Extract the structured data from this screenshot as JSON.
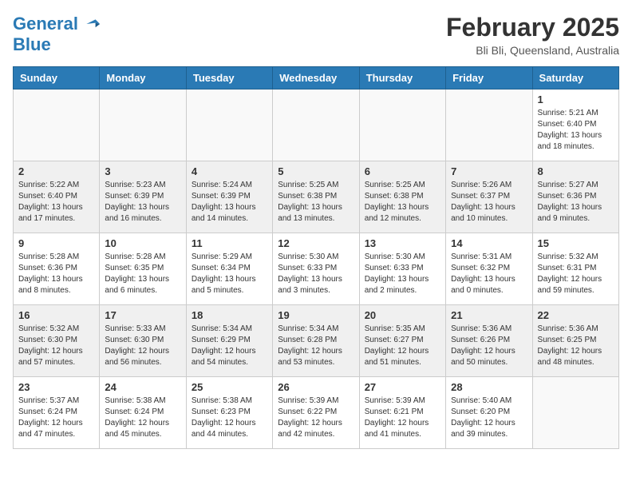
{
  "header": {
    "logo_line1": "General",
    "logo_line2": "Blue",
    "month_title": "February 2025",
    "location": "Bli Bli, Queensland, Australia"
  },
  "weekdays": [
    "Sunday",
    "Monday",
    "Tuesday",
    "Wednesday",
    "Thursday",
    "Friday",
    "Saturday"
  ],
  "weeks": [
    [
      {
        "day": "",
        "info": ""
      },
      {
        "day": "",
        "info": ""
      },
      {
        "day": "",
        "info": ""
      },
      {
        "day": "",
        "info": ""
      },
      {
        "day": "",
        "info": ""
      },
      {
        "day": "",
        "info": ""
      },
      {
        "day": "1",
        "info": "Sunrise: 5:21 AM\nSunset: 6:40 PM\nDaylight: 13 hours\nand 18 minutes."
      }
    ],
    [
      {
        "day": "2",
        "info": "Sunrise: 5:22 AM\nSunset: 6:40 PM\nDaylight: 13 hours\nand 17 minutes."
      },
      {
        "day": "3",
        "info": "Sunrise: 5:23 AM\nSunset: 6:39 PM\nDaylight: 13 hours\nand 16 minutes."
      },
      {
        "day": "4",
        "info": "Sunrise: 5:24 AM\nSunset: 6:39 PM\nDaylight: 13 hours\nand 14 minutes."
      },
      {
        "day": "5",
        "info": "Sunrise: 5:25 AM\nSunset: 6:38 PM\nDaylight: 13 hours\nand 13 minutes."
      },
      {
        "day": "6",
        "info": "Sunrise: 5:25 AM\nSunset: 6:38 PM\nDaylight: 13 hours\nand 12 minutes."
      },
      {
        "day": "7",
        "info": "Sunrise: 5:26 AM\nSunset: 6:37 PM\nDaylight: 13 hours\nand 10 minutes."
      },
      {
        "day": "8",
        "info": "Sunrise: 5:27 AM\nSunset: 6:36 PM\nDaylight: 13 hours\nand 9 minutes."
      }
    ],
    [
      {
        "day": "9",
        "info": "Sunrise: 5:28 AM\nSunset: 6:36 PM\nDaylight: 13 hours\nand 8 minutes."
      },
      {
        "day": "10",
        "info": "Sunrise: 5:28 AM\nSunset: 6:35 PM\nDaylight: 13 hours\nand 6 minutes."
      },
      {
        "day": "11",
        "info": "Sunrise: 5:29 AM\nSunset: 6:34 PM\nDaylight: 13 hours\nand 5 minutes."
      },
      {
        "day": "12",
        "info": "Sunrise: 5:30 AM\nSunset: 6:33 PM\nDaylight: 13 hours\nand 3 minutes."
      },
      {
        "day": "13",
        "info": "Sunrise: 5:30 AM\nSunset: 6:33 PM\nDaylight: 13 hours\nand 2 minutes."
      },
      {
        "day": "14",
        "info": "Sunrise: 5:31 AM\nSunset: 6:32 PM\nDaylight: 13 hours\nand 0 minutes."
      },
      {
        "day": "15",
        "info": "Sunrise: 5:32 AM\nSunset: 6:31 PM\nDaylight: 12 hours\nand 59 minutes."
      }
    ],
    [
      {
        "day": "16",
        "info": "Sunrise: 5:32 AM\nSunset: 6:30 PM\nDaylight: 12 hours\nand 57 minutes."
      },
      {
        "day": "17",
        "info": "Sunrise: 5:33 AM\nSunset: 6:30 PM\nDaylight: 12 hours\nand 56 minutes."
      },
      {
        "day": "18",
        "info": "Sunrise: 5:34 AM\nSunset: 6:29 PM\nDaylight: 12 hours\nand 54 minutes."
      },
      {
        "day": "19",
        "info": "Sunrise: 5:34 AM\nSunset: 6:28 PM\nDaylight: 12 hours\nand 53 minutes."
      },
      {
        "day": "20",
        "info": "Sunrise: 5:35 AM\nSunset: 6:27 PM\nDaylight: 12 hours\nand 51 minutes."
      },
      {
        "day": "21",
        "info": "Sunrise: 5:36 AM\nSunset: 6:26 PM\nDaylight: 12 hours\nand 50 minutes."
      },
      {
        "day": "22",
        "info": "Sunrise: 5:36 AM\nSunset: 6:25 PM\nDaylight: 12 hours\nand 48 minutes."
      }
    ],
    [
      {
        "day": "23",
        "info": "Sunrise: 5:37 AM\nSunset: 6:24 PM\nDaylight: 12 hours\nand 47 minutes."
      },
      {
        "day": "24",
        "info": "Sunrise: 5:38 AM\nSunset: 6:24 PM\nDaylight: 12 hours\nand 45 minutes."
      },
      {
        "day": "25",
        "info": "Sunrise: 5:38 AM\nSunset: 6:23 PM\nDaylight: 12 hours\nand 44 minutes."
      },
      {
        "day": "26",
        "info": "Sunrise: 5:39 AM\nSunset: 6:22 PM\nDaylight: 12 hours\nand 42 minutes."
      },
      {
        "day": "27",
        "info": "Sunrise: 5:39 AM\nSunset: 6:21 PM\nDaylight: 12 hours\nand 41 minutes."
      },
      {
        "day": "28",
        "info": "Sunrise: 5:40 AM\nSunset: 6:20 PM\nDaylight: 12 hours\nand 39 minutes."
      },
      {
        "day": "",
        "info": ""
      }
    ]
  ]
}
